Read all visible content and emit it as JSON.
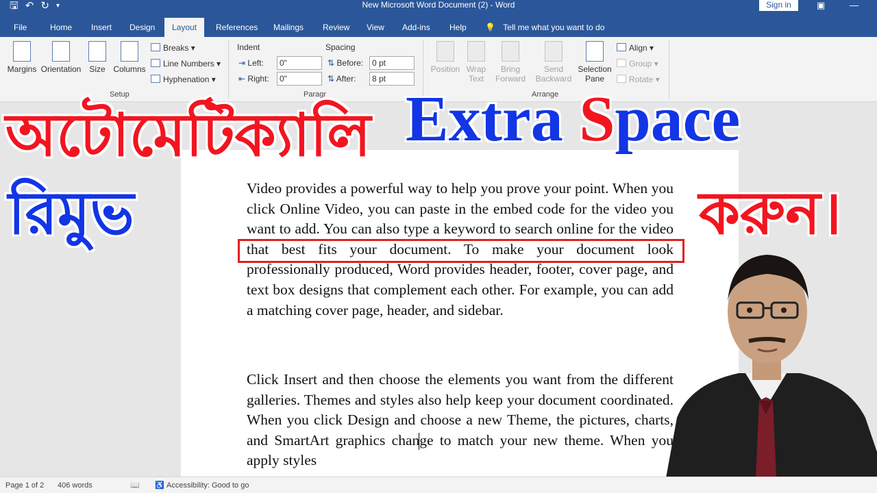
{
  "window": {
    "title": "New Microsoft Word Document (2)  -  Word",
    "sign_in": "Sign in"
  },
  "tabs": [
    "File",
    "Home",
    "Insert",
    "Design",
    "Layout",
    "References",
    "Mailings",
    "Review",
    "View",
    "Add-ins",
    "Help"
  ],
  "active_tab": "Layout",
  "tell_me": "Tell me what you want to do",
  "ribbon": {
    "page_setup": {
      "margins": "Margins",
      "orientation": "Orientation",
      "size": "Size",
      "columns": "Columns",
      "breaks": "Breaks",
      "line_numbers": "Line Numbers",
      "hyphenation": "Hyphenation",
      "group_label": "Setup"
    },
    "paragraph": {
      "indent_label": "Indent",
      "left_label": "Left:",
      "left_value": "0\"",
      "right_label": "Right:",
      "right_value": "0\"",
      "spacing_label": "Spacing",
      "before_label": "Before:",
      "before_value": "0 pt",
      "after_label": "After:",
      "after_value": "8 pt",
      "group_label": "Paragr"
    },
    "arrange": {
      "position": "Position",
      "wrap_text_1": "Wrap",
      "wrap_text_2": "Text",
      "bring_forward_1": "Bring",
      "bring_forward_2": "Forward",
      "send_backward_1": "Send",
      "send_backward_2": "Backward",
      "selection_pane_1": "Selection",
      "selection_pane_2": "Pane",
      "align": "Align",
      "group": "Group",
      "rotate": "Rotate",
      "group_label": "Arrange"
    }
  },
  "overlay": {
    "bengali_line1": "অটোমেটিক্যালি",
    "english_extra": "Extra ",
    "english_s": "S",
    "english_pace": "pace",
    "bengali_line2": "রিমুভ",
    "bengali_line3": "করুন।"
  },
  "document": {
    "paragraph1": "Video provides a powerful way to help you prove your point. When you click Online Video, you can paste in the embed code for the video you want to add. You can also type a keyword to search online for the video that best fits your document. To make your document look professionally produced, Word provides header, footer, cover page, and text box designs that complement each other. For example, you can add a matching cover page, header, and sidebar.",
    "paragraph2": "Click Insert and then choose the elements you want from the different galleries. Themes and styles also help keep your document coordinated. When you click Design and choose a new Theme, the pictures, charts, and SmartArt graphics change to match your new theme. When you apply styles"
  },
  "status_bar": {
    "page": "Page 1 of 2",
    "words": "406 words",
    "accessibility": "Accessibility: Good to go"
  }
}
